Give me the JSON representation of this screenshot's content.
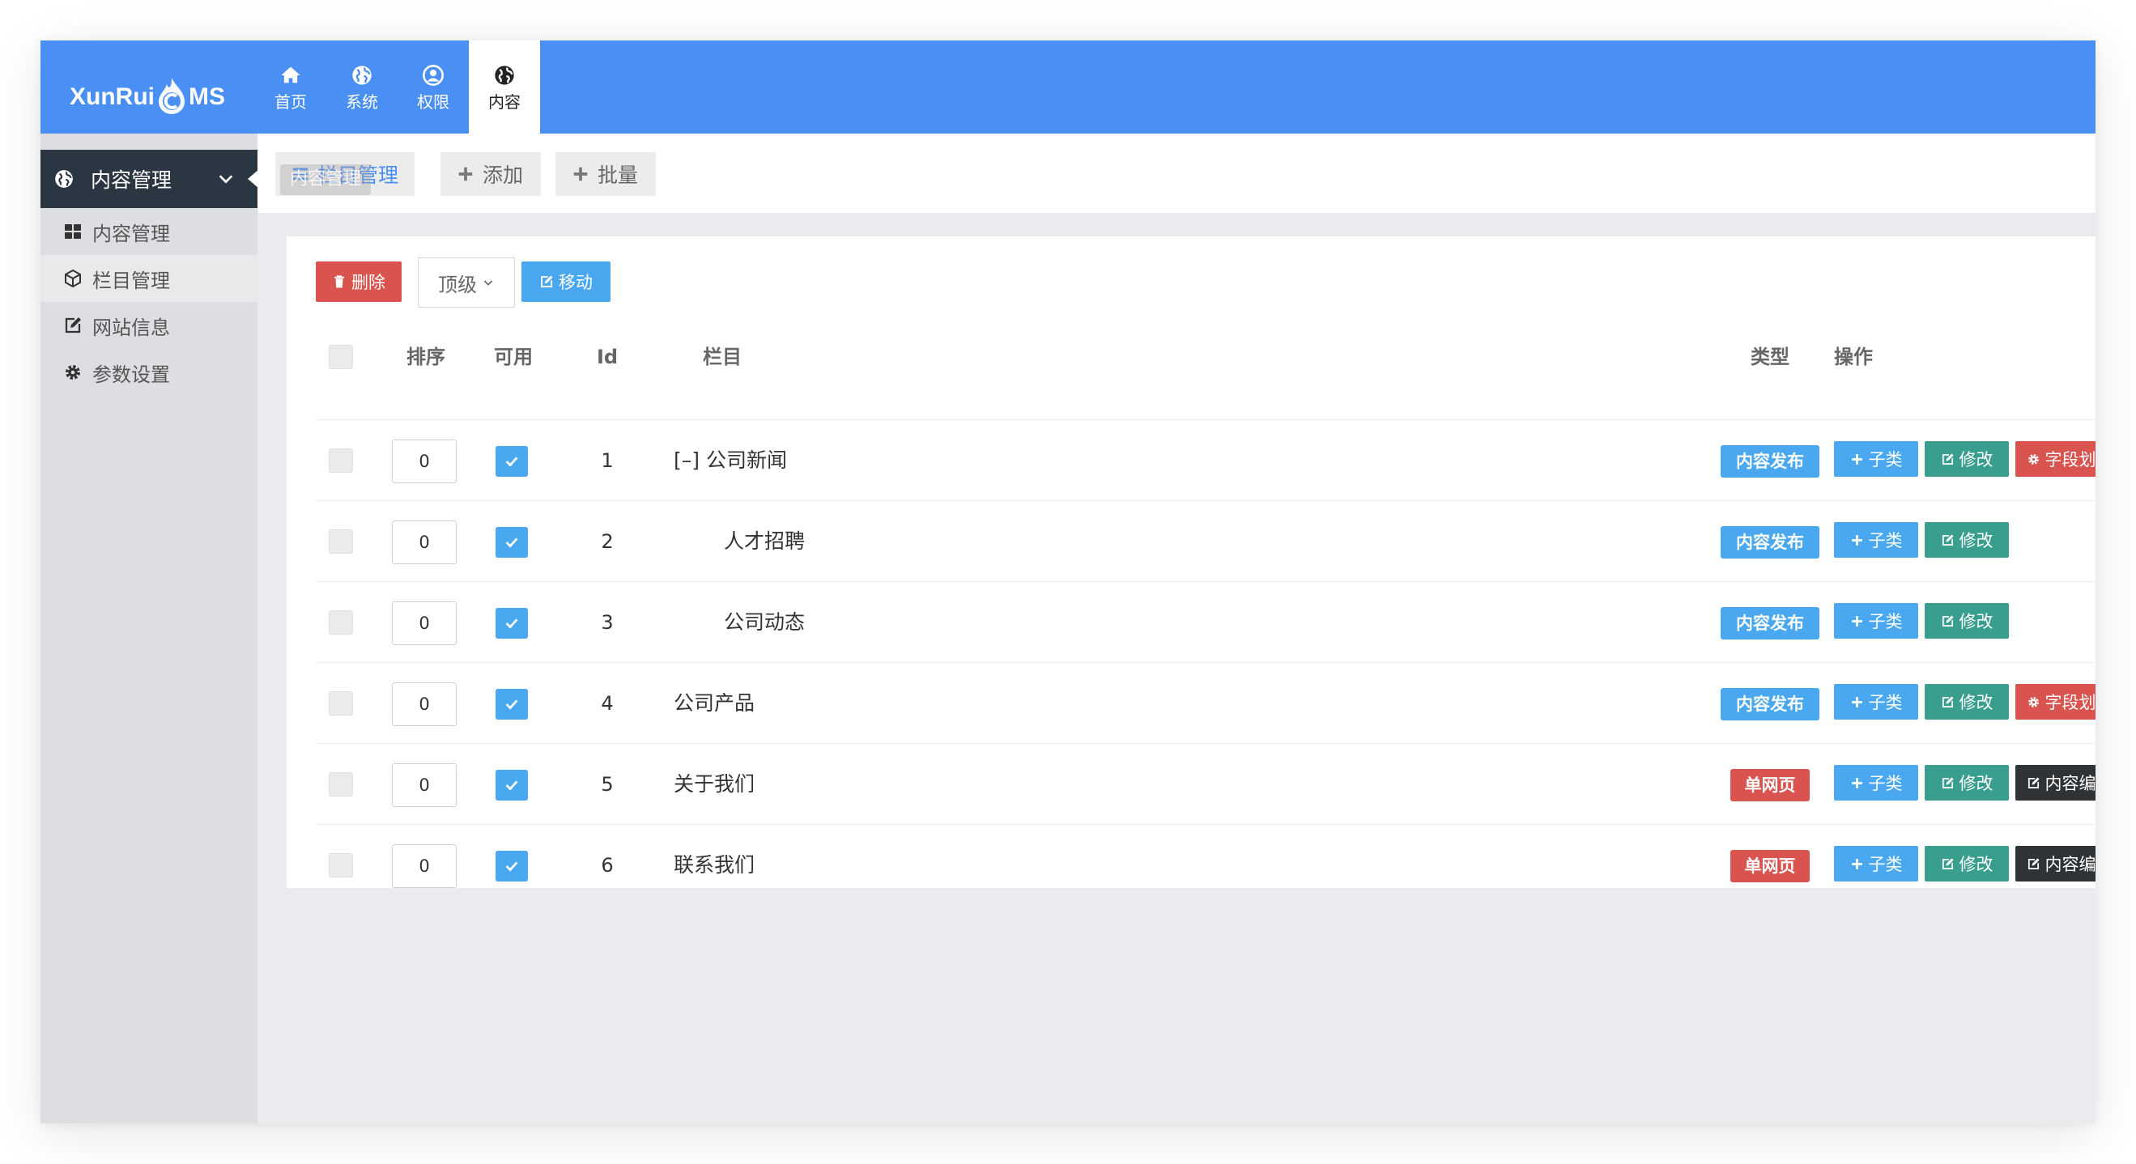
{
  "app": {
    "logo_left": "XunRui",
    "logo_right": "MS"
  },
  "topnav": [
    {
      "label": "首页",
      "icon": "home-icon"
    },
    {
      "label": "系统",
      "icon": "globe-icon"
    },
    {
      "label": "权限",
      "icon": "user-icon"
    },
    {
      "label": "内容",
      "icon": "globe-icon",
      "active": true
    }
  ],
  "sidebar": {
    "header": "内容管理",
    "items": [
      {
        "label": "内容管理",
        "icon": "grid-icon"
      },
      {
        "label": "栏目管理",
        "icon": "cube-icon",
        "active": true
      },
      {
        "label": "网站信息",
        "icon": "edit-icon"
      },
      {
        "label": "参数设置",
        "icon": "gear-icon"
      }
    ]
  },
  "toolbar": {
    "tabs": [
      {
        "label": "栏目管理",
        "icon": "list-icon",
        "active": true
      },
      {
        "label": "添加",
        "icon": "plus-icon"
      },
      {
        "label": "批量",
        "icon": "plus-icon"
      }
    ],
    "tooltip": "内容管理"
  },
  "actions": {
    "delete": "删除",
    "level_select": "顶级",
    "move": "移动"
  },
  "table": {
    "headers": {
      "order": "排序",
      "available": "可用",
      "id": "Id",
      "column": "栏目",
      "type": "类型",
      "ops": "操作"
    },
    "rows": [
      {
        "order": "0",
        "id": "1",
        "name": "[–]  公司新闻",
        "type": "内容发布",
        "ops": [
          "子类",
          "修改",
          "字段划分"
        ]
      },
      {
        "order": "0",
        "id": "2",
        "name": "人才招聘",
        "type": "内容发布",
        "ops": [
          "子类",
          "修改"
        ]
      },
      {
        "order": "0",
        "id": "3",
        "name": "公司动态",
        "type": "内容发布",
        "ops": [
          "子类",
          "修改"
        ]
      },
      {
        "order": "0",
        "id": "4",
        "name": "公司产品",
        "type": "内容发布",
        "ops": [
          "子类",
          "修改",
          "字段划分"
        ]
      },
      {
        "order": "0",
        "id": "5",
        "name": "关于我们",
        "type": "单网页",
        "ops": [
          "子类",
          "修改",
          "内容编辑"
        ]
      },
      {
        "order": "0",
        "id": "6",
        "name": "联系我们",
        "type": "单网页",
        "ops": [
          "子类",
          "修改",
          "内容编辑"
        ]
      }
    ]
  },
  "colors": {
    "header": "#4a8ff4",
    "sidebar_head": "#2b3643",
    "danger": "#d9534f",
    "info": "#4aa8f0",
    "success": "#3a9e8f",
    "dark": "#2f3336"
  }
}
